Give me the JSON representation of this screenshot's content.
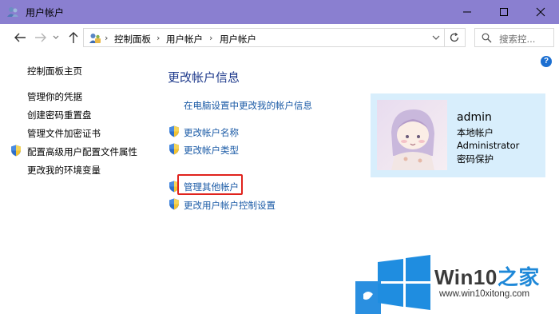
{
  "window": {
    "title": "用户帐户",
    "controls": [
      "minimize-icon",
      "maximize-icon",
      "close-icon"
    ],
    "titlebar_color": "#8a7fd0"
  },
  "address_bar": {
    "breadcrumbs": [
      "控制面板",
      "用户帐户",
      "用户帐户"
    ],
    "search_placeholder": "搜索控..."
  },
  "sidebar": {
    "home_link": "控制面板主页",
    "items": [
      {
        "label": "管理你的凭据",
        "shield": false
      },
      {
        "label": "创建密码重置盘",
        "shield": false
      },
      {
        "label": "管理文件加密证书",
        "shield": false
      },
      {
        "label": "配置高级用户配置文件属性",
        "shield": true
      },
      {
        "label": "更改我的环境变量",
        "shield": false
      }
    ]
  },
  "main": {
    "heading": "更改帐户信息",
    "links": [
      {
        "label": "在电脑设置中更改我的帐户信息",
        "shield": false
      },
      {
        "label": "更改帐户名称",
        "shield": true
      },
      {
        "label": "更改帐户类型",
        "shield": true
      },
      {
        "label": "管理其他帐户",
        "shield": true,
        "highlighted": true
      },
      {
        "label": "更改用户帐户控制设置",
        "shield": true
      }
    ],
    "link_color": "#1a5aa6",
    "highlight_color": "#e0231d"
  },
  "user_card": {
    "name": "admin",
    "account_type": "本地帐户",
    "role": "Administrator",
    "protection": "密码保护"
  },
  "watermark": {
    "brand": "Win10",
    "brand_suffix": "之家",
    "url": "www.win10xitong.com"
  },
  "help_label": "?"
}
